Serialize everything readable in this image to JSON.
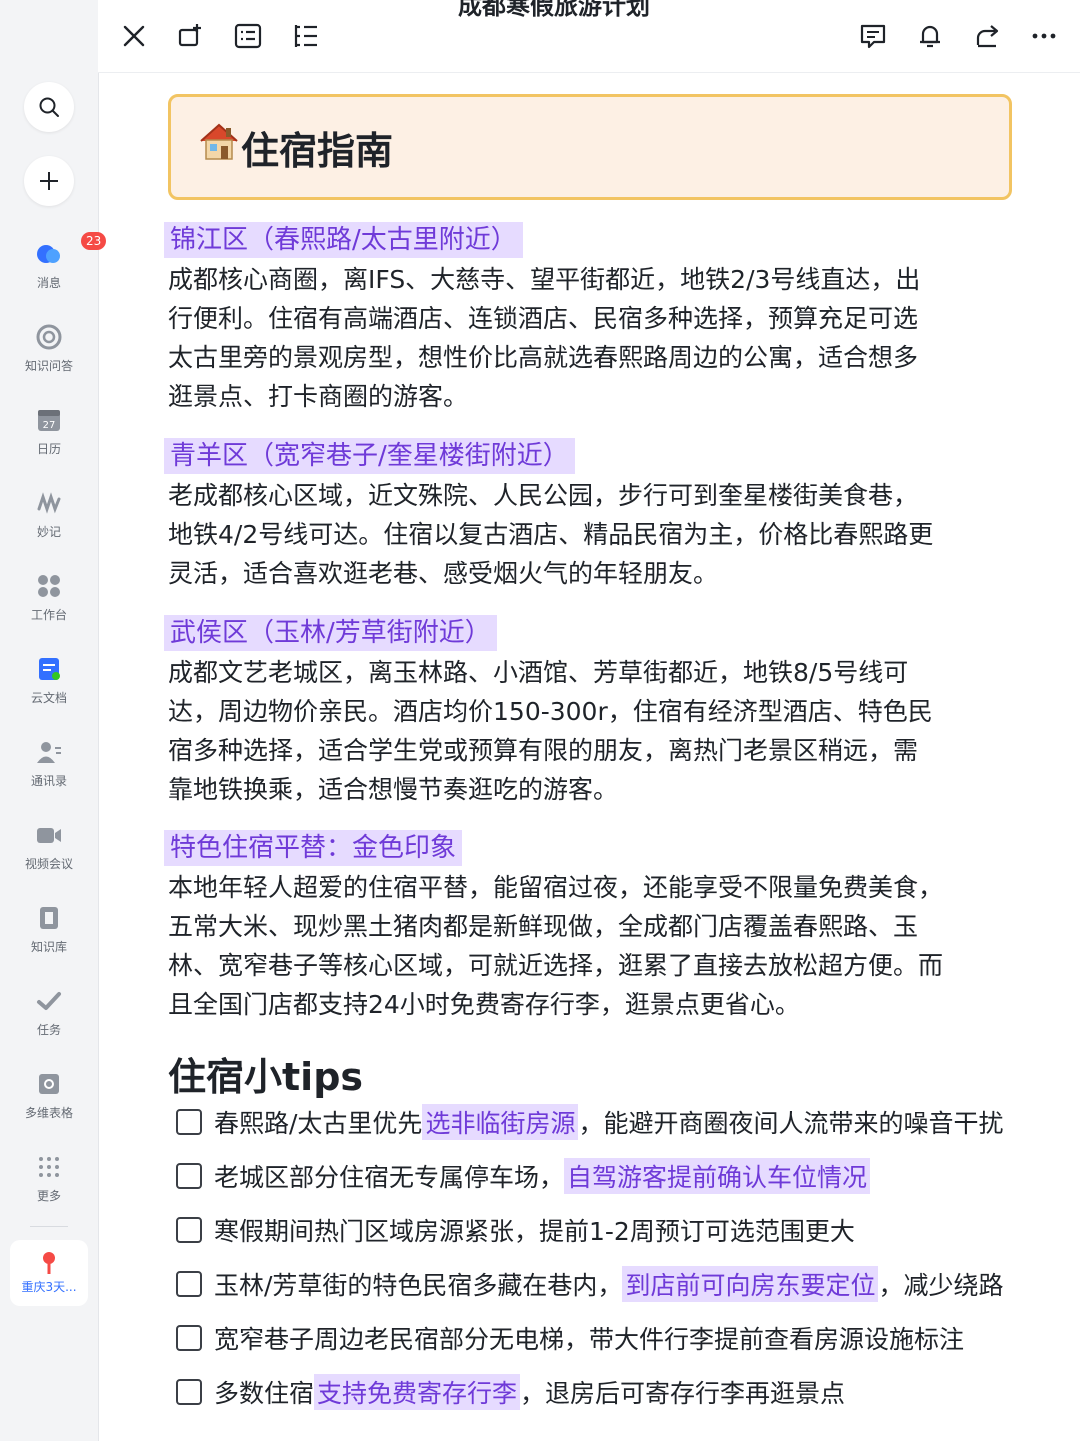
{
  "sidebar": {
    "messages_badge": "23",
    "items": [
      {
        "label": "消息"
      },
      {
        "label": "知识问答"
      },
      {
        "label": "日历",
        "icon_text": "27"
      },
      {
        "label": "妙记"
      },
      {
        "label": "工作台"
      },
      {
        "label": "云文档"
      },
      {
        "label": "通讯录"
      },
      {
        "label": "视频会议"
      },
      {
        "label": "知识库"
      },
      {
        "label": "任务"
      },
      {
        "label": "多维表格"
      },
      {
        "label": "更多"
      }
    ],
    "recent_label": "重庆3天..."
  },
  "toolbar": {
    "doc_title": "成都寒假旅游计划"
  },
  "callout": {
    "title": "住宿指南"
  },
  "sections": [
    {
      "heading": "锦江区（春熙路/太古里附近）",
      "lines": [
        "成都核心商圈，离IFS、大慈寺、望平街都近，地铁2/3号线直达，出",
        "行便利。住宿有高端酒店、连锁酒店、民宿多种选择，预算充足可选",
        "太古里旁的景观房型，想性价比高就选春熙路周边的公寓，适合想多",
        "逛景点、打卡商圈的游客。"
      ]
    },
    {
      "heading": "青羊区（宽窄巷子/奎星楼街附近）",
      "lines": [
        "老成都核心区域，近文殊院、人民公园，步行可到奎星楼街美食巷，",
        "地铁4/2号线可达。住宿以复古酒店、精品民宿为主，价格比春熙路更",
        "灵活，适合喜欢逛老巷、感受烟火气的年轻朋友。"
      ]
    },
    {
      "heading": "武侯区（玉林/芳草街附近）",
      "lines": [
        "成都文艺老城区，离玉林路、小酒馆、芳草街都近，地铁8/5号线可",
        "达，周边物价亲民。酒店均价150-300r，住宿有经济型酒店、特色民",
        "宿多种选择，适合学生党或预算有限的朋友，离热门老景区稍远，需",
        "靠地铁换乘，适合想慢节奏逛吃的游客。"
      ]
    },
    {
      "heading": "特色住宿平替：金色印象",
      "lines": [
        "本地年轻人超爱的住宿平替，能留宿过夜，还能享受不限量免费美食，",
        "五常大米、现炒黑土猪肉都是新鲜现做，全成都门店覆盖春熙路、玉",
        "林、宽窄巷子等核心区域，可就近选择，逛累了直接去放松超方便。而",
        "且全国门店都支持24小时免费寄存行李，逛景点更省心。"
      ]
    }
  ],
  "tips": {
    "title": "住宿小tips",
    "items": [
      {
        "pre": "春熙路/太古里优先",
        "hl": "选非临街房源",
        "post": "，能避开商圈夜间人流带来的噪音干扰"
      },
      {
        "pre": "老城区部分住宿无专属停车场，",
        "hl": "自驾游客提前确认车位情况",
        "post": ""
      },
      {
        "pre": "寒假期间热门区域房源紧张，提前1-2周预订可选范围更大",
        "hl": "",
        "post": ""
      },
      {
        "pre": "玉林/芳草街的特色民宿多藏在巷内，",
        "hl": "到店前可向房东要定位",
        "post": "，减少绕路"
      },
      {
        "pre": "宽窄巷子周边老民宿部分无电梯，带大件行李提前查看房源设施标注",
        "hl": "",
        "post": ""
      },
      {
        "pre": "多数住宿",
        "hl": "支持免费寄存行李",
        "post": "，退房后可寄存行李再逛景点"
      }
    ]
  },
  "colors": {
    "highlight_bg": "#e6dbff",
    "highlight_text": "#6f3ad8",
    "callout_bg": "#fdf0e4",
    "callout_border": "#f2c462",
    "badge": "#f54a45",
    "link_blue": "#3370ff"
  }
}
